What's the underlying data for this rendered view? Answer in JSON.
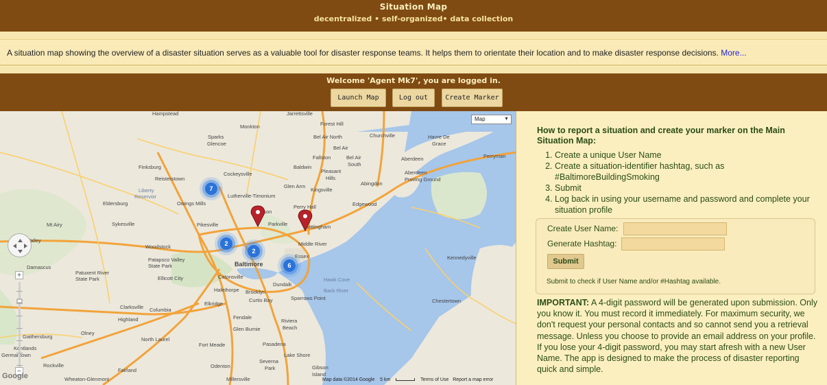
{
  "header": {
    "title": "Situation Map",
    "subtitle": "decentralized • self-organized• data collection"
  },
  "intro": {
    "text": "A situation map showing the overview of a disaster situation serves as a valuable tool for disaster response teams. It helps them to orientate their location and to make disaster response decisions. ",
    "more_link": "More..."
  },
  "welcome": {
    "text": "Welcome 'Agent Mk7', you are logged in."
  },
  "buttons": {
    "launch_map": "Launch Map",
    "log_out": "Log out",
    "create_marker": "Create Marker"
  },
  "map": {
    "type_selector": "Map",
    "clusters": [
      "7",
      "2",
      "2",
      "6"
    ],
    "footer": {
      "attribution": "Map data ©2014 Google",
      "scale": "5 km",
      "terms": "Terms of Use",
      "report": "Report a map error"
    },
    "logo": "Google",
    "places": [
      "Hampstead",
      "Jarrettsville",
      "Forest Hill",
      "Bel Air North",
      "Churchville",
      "Havre De Grace",
      "Monkton",
      "Sparks Glencoe",
      "Bel Air",
      "Bel Air South",
      "Fallston",
      "Aberdeen",
      "Perryman",
      "Finksburg",
      "Reisterstown",
      "Cockeysville",
      "Baldwin",
      "Pleasant Hills",
      "Abingdon",
      "Aberdeen Proving Ground",
      "Liberty Reservoir",
      "Lutherville-Timonium",
      "Glen Arm",
      "Kingsville",
      "Owings Mills",
      "Edgewood",
      "Perry Hall",
      "Eldersburg",
      "Mt Airy",
      "Towson",
      "Pikesville",
      "Parkville",
      "Nottingham",
      "Sykesville",
      "Glen",
      "Gwynn Oak",
      "Middle River",
      "Green Valley",
      "Woodstock",
      "Patapsco Valley State Park",
      "Baltimore",
      "Essex",
      "Damascus",
      "Ellicott City",
      "Patuxent River State Park",
      "Catonsville",
      "Dundalk",
      "Kennedyville",
      "Halethorpe",
      "Brooklyn",
      "Curtis Bay",
      "Elkridge",
      "Clarksville",
      "Columbia",
      "Highland",
      "Fendale",
      "Olney",
      "Glen Burnie",
      "North Laurel",
      "Gaithersburg",
      "Germantown",
      "Kentlands",
      "Rockville",
      "Pasadena",
      "Lake Shore",
      "Severna Park",
      "Odenton",
      "Fairland",
      "Gibson Island",
      "Millersville",
      "Wheaton-Glenmont",
      "Chestertown",
      "Riviera Beach",
      "Sparrows Point",
      "Hawk Cove",
      "Back River",
      "Fort Meade"
    ]
  },
  "instructions": {
    "heading": "How to report a situation and create your marker on the Main Situation Map:",
    "steps": [
      "Create a unique User Name",
      "Create a situation-identifier hashtag, such as #BaltimoreBuildingSmoking",
      "Submit",
      "Log back in using your username and password and complete your situation profile"
    ]
  },
  "form": {
    "username_label": "Create User Name:",
    "username_value": "",
    "hashtag_label": "Generate Hashtag:",
    "hashtag_value": "",
    "submit_label": "Submit",
    "note": "Submit to check if User Name and/or #Hashtag available."
  },
  "important": {
    "label": "IMPORTANT:",
    "text": " A 4-digit password will be generated upon submission. Only you know it. You must record it immediately. For maximum security, we don't request your personal contacts and so cannot send you a retrieval message. Unless you choose to provide an email address on your profile. If you lose your 4-digit password, you may start afresh with a new User Name. The app is designed to make the process of disaster reporting quick and simple."
  },
  "colors": {
    "header_brown": "#7f4b12",
    "panel_cream": "#fbefc0",
    "text_green": "#2a4c16",
    "link_blue": "#2525d6",
    "cluster_blue": "#2b73d9",
    "marker_red": "#b8232b",
    "water": "#a6c6ea",
    "highway": "#f2a33a"
  }
}
